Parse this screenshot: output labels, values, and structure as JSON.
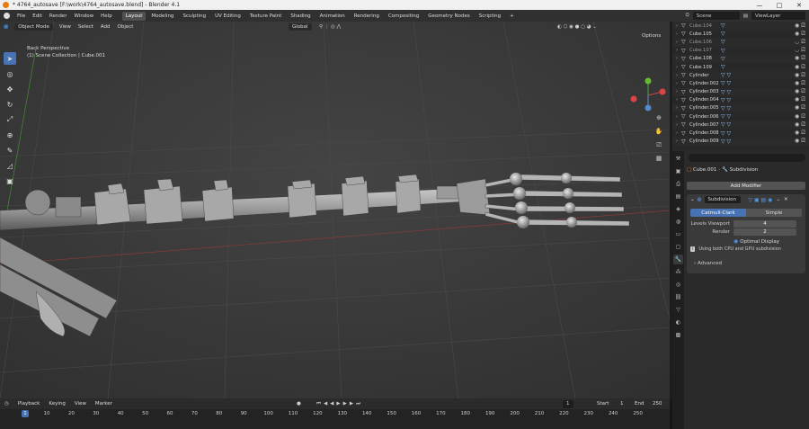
{
  "window": {
    "title": "* 4764_autosave [F:\\work\\4764_autosave.blend] - Blender 4.1",
    "controls": [
      "—",
      "□",
      "✕"
    ]
  },
  "menu": {
    "items": [
      "File",
      "Edit",
      "Render",
      "Window",
      "Help"
    ],
    "workspaces": [
      "Layout",
      "Modeling",
      "Sculpting",
      "UV Editing",
      "Texture Paint",
      "Shading",
      "Animation",
      "Rendering",
      "Compositing",
      "Geometry Nodes",
      "Scripting",
      "+"
    ],
    "active_workspace": "Layout",
    "scene": "Scene",
    "view_layer": "ViewLayer"
  },
  "viewport": {
    "mode": "Object Mode",
    "menus": [
      "View",
      "Select",
      "Add",
      "Object"
    ],
    "orientation": "Global",
    "line1": "Back Perspective",
    "line2": "(1) Scene Collection | Cube.001",
    "options": "Options"
  },
  "outliner": {
    "rows": [
      {
        "name": "Cube.104",
        "mods": "▽",
        "dim": true
      },
      {
        "name": "Cube.105",
        "mods": "▽"
      },
      {
        "name": "Cube.106",
        "mods": "▽",
        "dim": true
      },
      {
        "name": "Cube.107",
        "mods": "▽",
        "dim": true
      },
      {
        "name": "Cube.108",
        "mods": "▽"
      },
      {
        "name": "Cube.109",
        "mods": "▽"
      },
      {
        "name": "Cylinder",
        "mods": "▽ ▽"
      },
      {
        "name": "Cylinder.002",
        "mods": "▽ ▽"
      },
      {
        "name": "Cylinder.003",
        "mods": "▽ ▽"
      },
      {
        "name": "Cylinder.004",
        "mods": "▽ ▽"
      },
      {
        "name": "Cylinder.005",
        "mods": "▽ ▽"
      },
      {
        "name": "Cylinder.006",
        "mods": "▽ ▽"
      },
      {
        "name": "Cylinder.007",
        "mods": "▽ ▽"
      },
      {
        "name": "Cylinder.008",
        "mods": "▽ ▽"
      },
      {
        "name": "Cylinder.009",
        "mods": "▽ ▽"
      }
    ]
  },
  "properties": {
    "object": "Cube.001",
    "modifier_tab": "Subdivision",
    "add_modifier": "Add Modifier",
    "modifier": {
      "name": "Subdivision",
      "seg_on": "Catmull-Clark",
      "seg_off": "Simple",
      "levels_label": "Levels Viewport",
      "levels_value": "4",
      "render_label": "Render",
      "render_value": "2",
      "optimal": "Optimal Display",
      "info": "Using both CPU and GPU subdivision",
      "advanced": "Advanced"
    }
  },
  "timeline": {
    "menus": [
      "Playback",
      "Keying",
      "View",
      "Marker"
    ],
    "current": "1",
    "start_label": "Start",
    "start": "1",
    "end_label": "End",
    "end": "250",
    "ticks": [
      "10",
      "20",
      "30",
      "40",
      "50",
      "60",
      "70",
      "80",
      "90",
      "100",
      "110",
      "120",
      "130",
      "140",
      "150",
      "160",
      "170",
      "180",
      "190",
      "200",
      "210",
      "220",
      "230",
      "240",
      "250"
    ],
    "frame_marker": "1"
  }
}
